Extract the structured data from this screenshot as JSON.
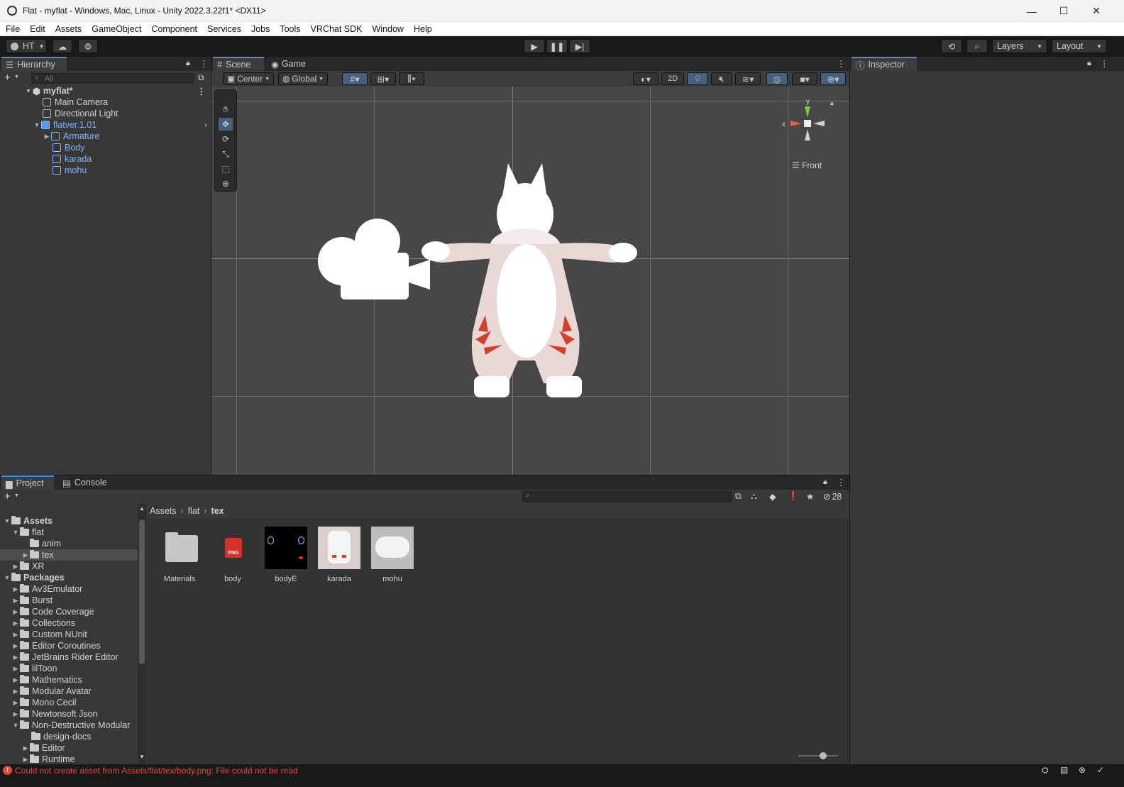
{
  "window": {
    "title": "Flat - myflat - Windows, Mac, Linux - Unity 2022.3.22f1* <DX11>",
    "minimize": "—",
    "maximize": "☐",
    "close": "✕"
  },
  "menu": [
    "File",
    "Edit",
    "Assets",
    "GameObject",
    "Component",
    "Services",
    "Jobs",
    "Tools",
    "VRChat SDK",
    "Window",
    "Help"
  ],
  "toolbar": {
    "account": "HT",
    "layers": "Layers",
    "layout": "Layout"
  },
  "hierarchy": {
    "tab": "Hierarchy",
    "search_placeholder": "All",
    "scene": "myflat*",
    "items": [
      {
        "label": "Main Camera"
      },
      {
        "label": "Directional Light"
      },
      {
        "label": "flatver.1.01"
      },
      {
        "label": "Armature"
      },
      {
        "label": "Body"
      },
      {
        "label": "karada"
      },
      {
        "label": "mohu"
      }
    ]
  },
  "scene_view": {
    "tabs": [
      "Scene",
      "Game"
    ],
    "pivot": "Center",
    "space": "Global",
    "mode_2d": "2D",
    "gizmo_label": "Front",
    "axis_y": "y",
    "axis_x": "x"
  },
  "inspector": {
    "tab": "Inspector"
  },
  "project": {
    "tabs": [
      "Project",
      "Console"
    ],
    "hidden_count": "28",
    "breadcrumb": [
      "Assets",
      "flat",
      "tex"
    ],
    "tree": [
      {
        "label": "Assets"
      },
      {
        "label": "flat"
      },
      {
        "label": "anim"
      },
      {
        "label": "tex"
      },
      {
        "label": "XR"
      },
      {
        "label": "Packages"
      },
      {
        "label": "Av3Emulator"
      },
      {
        "label": "Burst"
      },
      {
        "label": "Code Coverage"
      },
      {
        "label": "Collections"
      },
      {
        "label": "Custom NUnit"
      },
      {
        "label": "Editor Coroutines"
      },
      {
        "label": "JetBrains Rider Editor"
      },
      {
        "label": "lilToon"
      },
      {
        "label": "Mathematics"
      },
      {
        "label": "Modular Avatar"
      },
      {
        "label": "Mono Cecil"
      },
      {
        "label": "Newtonsoft Json"
      },
      {
        "label": "Non-Destructive Modular"
      },
      {
        "label": "design-docs"
      },
      {
        "label": "Editor"
      },
      {
        "label": "Runtime"
      }
    ],
    "assets": [
      {
        "label": "Materials"
      },
      {
        "label": "body"
      },
      {
        "label": "bodyE"
      },
      {
        "label": "karada"
      },
      {
        "label": "mohu"
      }
    ],
    "png_badge": "PNG"
  },
  "status": {
    "error": "Could not create asset from Assets/flat/tex/body.png: File could not be read"
  },
  "colors": {
    "accent": "#4a8fe0",
    "selected_blue": "#7fb2ff",
    "error_red": "#e04b3a"
  }
}
